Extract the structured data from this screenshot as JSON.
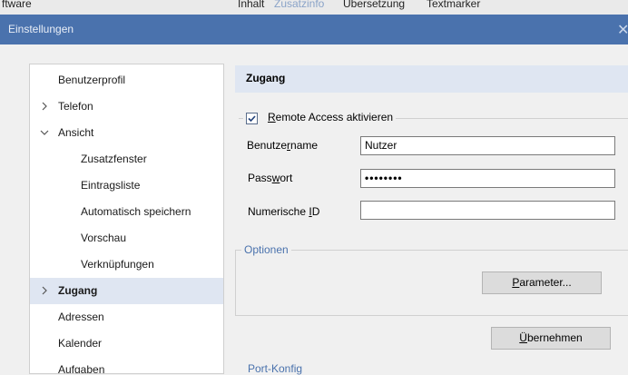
{
  "background_tabs": [
    "ftware",
    "Inhalt",
    "Zusatzinfo",
    "Übersetzung",
    "Textmarker"
  ],
  "window": {
    "title": "Einstellungen",
    "close_glyph": "✕"
  },
  "nav": {
    "items": [
      {
        "label": "Benutzerprofil",
        "chevron": ""
      },
      {
        "label": "Telefon",
        "chevron": "right"
      },
      {
        "label": "Ansicht",
        "chevron": "down"
      },
      {
        "label": "Zusatzfenster",
        "chevron": ""
      },
      {
        "label": "Eintragsliste",
        "chevron": ""
      },
      {
        "label": "Automatisch speichern",
        "chevron": ""
      },
      {
        "label": "Vorschau",
        "chevron": ""
      },
      {
        "label": "Verknüpfungen",
        "chevron": ""
      },
      {
        "label": "Zugang",
        "chevron": "right",
        "selected": true
      },
      {
        "label": "Adressen",
        "chevron": ""
      },
      {
        "label": "Kalender",
        "chevron": ""
      },
      {
        "label": "Aufgaben",
        "chevron": ""
      }
    ]
  },
  "panel": {
    "header": "Zugang",
    "remote_access": {
      "checked": true,
      "label_underlined": "R",
      "label_rest": "emote Access aktivieren"
    },
    "fields": {
      "username": {
        "label_pre": "Benutze",
        "label_u": "r",
        "label_post": "name",
        "value": "Nutzer"
      },
      "password": {
        "label_pre": "Pass",
        "label_u": "w",
        "label_post": "ort",
        "value": "••••••••"
      },
      "numeric_id": {
        "label_pre": "Numerische ",
        "label_u": "I",
        "label_post": "D",
        "value": ""
      }
    },
    "options": {
      "legend": "Optionen",
      "parameter_button": {
        "u": "P",
        "rest": "arameter..."
      }
    },
    "apply_button": {
      "u": "Ü",
      "rest": "bernehmen"
    },
    "bottom_partial_legend": "Port-Konfig"
  },
  "colors": {
    "titlebar": "#4a72ad",
    "selection": "#dfe6f2",
    "accent_legend": "#4a72ad"
  }
}
